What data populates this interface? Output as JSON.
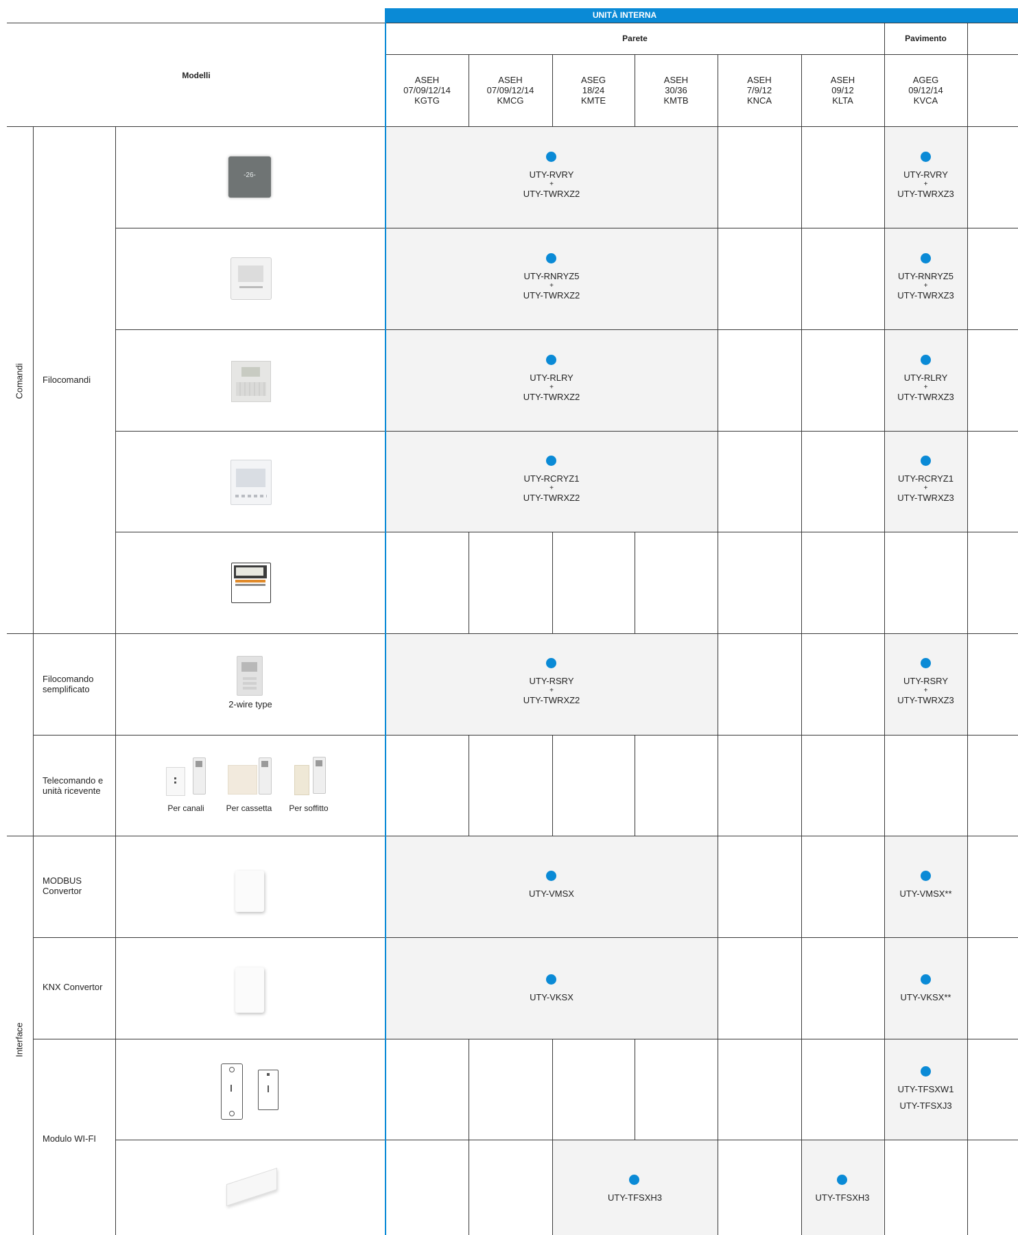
{
  "header": {
    "unita_interna": "UNITÀ INTERNA",
    "parete": "Parete",
    "pavimento": "Pavimento",
    "modelli": "Modelli"
  },
  "columns": [
    {
      "line1": "ASEH",
      "line2": "07/09/12/14",
      "line3": "KGTG"
    },
    {
      "line1": "ASEH",
      "line2": "07/09/12/14",
      "line3": "KMCG"
    },
    {
      "line1": "ASEG",
      "line2": "18/24",
      "line3": "KMTE"
    },
    {
      "line1": "ASEH",
      "line2": "30/36",
      "line3": "KMTB"
    },
    {
      "line1": "ASEH",
      "line2": "7/9/12",
      "line3": "KNCA"
    },
    {
      "line1": "ASEH",
      "line2": "09/12",
      "line3": "KLTA"
    },
    {
      "line1": "AGEG",
      "line2": "09/12/14",
      "line3": "KVCA"
    }
  ],
  "groups": {
    "comandi": "Comandi",
    "interface": "Interface"
  },
  "subgroups": {
    "filocomandi": "Filocomandi",
    "filocomando_semplificato": "Filocomando semplificato",
    "telecomando": "Telecomando e unità ricevente",
    "modbus": "MODBUS Convertor",
    "knx": "KNX Convertor",
    "wifi": "Modulo WI-FI"
  },
  "captions": {
    "two_wire": "2-wire type",
    "per_canali": "Per canali",
    "per_cassetta": "Per cassetta",
    "per_soffitto": "Per soffitto"
  },
  "cells": {
    "r1_wall": {
      "a": "UTY-RVRY",
      "plus": "+",
      "b": "UTY-TWRXZ2"
    },
    "r1_floor": {
      "a": "UTY-RVRY",
      "plus": "+",
      "b": "UTY-TWRXZ3"
    },
    "r2_wall": {
      "a": "UTY-RNRYZ5",
      "plus": "+",
      "b": "UTY-TWRXZ2"
    },
    "r2_floor": {
      "a": "UTY-RNRYZ5",
      "plus": "+",
      "b": "UTY-TWRXZ3"
    },
    "r3_wall": {
      "a": "UTY-RLRY",
      "plus": "+",
      "b": "UTY-TWRXZ2"
    },
    "r3_floor": {
      "a": "UTY-RLRY",
      "plus": "+",
      "b": "UTY-TWRXZ3"
    },
    "r4_wall": {
      "a": "UTY-RCRYZ1",
      "plus": "+",
      "b": "UTY-TWRXZ2"
    },
    "r4_floor": {
      "a": "UTY-RCRYZ1",
      "plus": "+",
      "b": "UTY-TWRXZ3"
    },
    "r6_wall": {
      "a": "UTY-RSRY",
      "plus": "+",
      "b": "UTY-TWRXZ2"
    },
    "r6_floor": {
      "a": "UTY-RSRY",
      "plus": "+",
      "b": "UTY-TWRXZ3"
    },
    "r8_wall": "UTY-VMSX",
    "r8_floor": "UTY-VMSX**",
    "r9_wall": "UTY-VKSX",
    "r9_floor": "UTY-VKSX**",
    "r10_floor_a": "UTY-TFSXW1",
    "r10_floor_b": "UTY-TFSXJ3",
    "r11_mid": "UTY-TFSXH3",
    "r11_klta": "UTY-TFSXH3"
  },
  "display": {
    "thermostat": "-26-"
  },
  "colors": {
    "accent": "#0a8ad6",
    "shade": "#f3f3f3"
  }
}
